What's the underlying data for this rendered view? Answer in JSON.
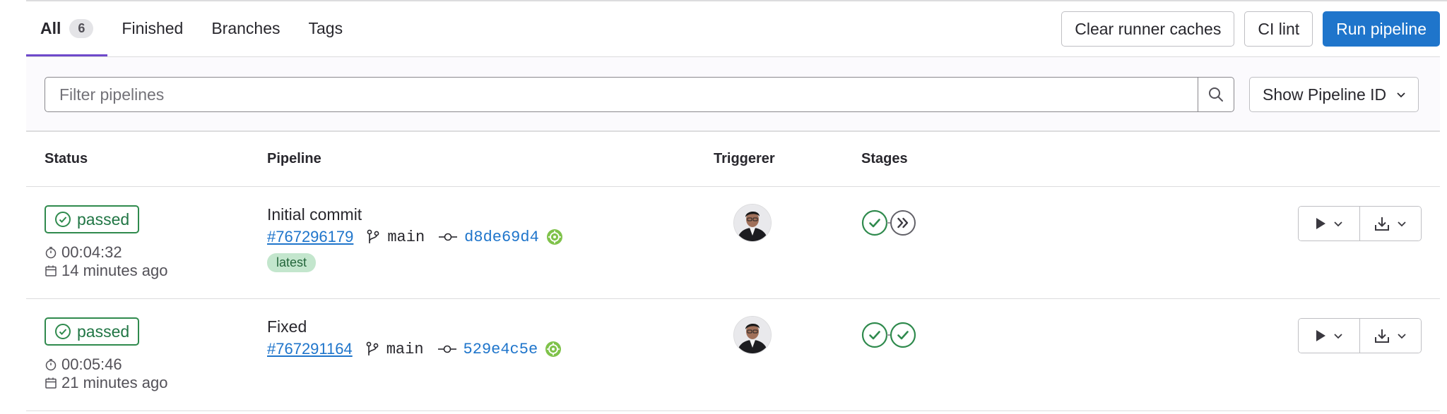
{
  "tabs": [
    {
      "label": "All",
      "count": "6"
    },
    {
      "label": "Finished"
    },
    {
      "label": "Branches"
    },
    {
      "label": "Tags"
    }
  ],
  "actions": {
    "clear_caches": "Clear runner caches",
    "ci_lint": "CI lint",
    "run_pipeline": "Run pipeline"
  },
  "filter": {
    "placeholder": "Filter pipelines",
    "show_id_label": "Show Pipeline ID"
  },
  "table": {
    "headers": {
      "status": "Status",
      "pipeline": "Pipeline",
      "triggerer": "Triggerer",
      "stages": "Stages"
    },
    "rows": [
      {
        "status": "passed",
        "duration": "00:04:32",
        "finished": "14 minutes ago",
        "commit_title": "Initial commit",
        "pipeline_id": "#767296179",
        "ref": "main",
        "sha": "d8de69d4",
        "badge": "latest",
        "stages": [
          "success",
          "skipped"
        ]
      },
      {
        "status": "passed",
        "duration": "00:05:46",
        "finished": "21 minutes ago",
        "commit_title": "Fixed",
        "pipeline_id": "#767291164",
        "ref": "main",
        "sha": "529e4c5e",
        "badge": "",
        "stages": [
          "success",
          "success"
        ]
      }
    ]
  },
  "colors": {
    "primary": "#1f75cb",
    "success": "#2f8a4d",
    "active_tab": "#6e49cb"
  }
}
